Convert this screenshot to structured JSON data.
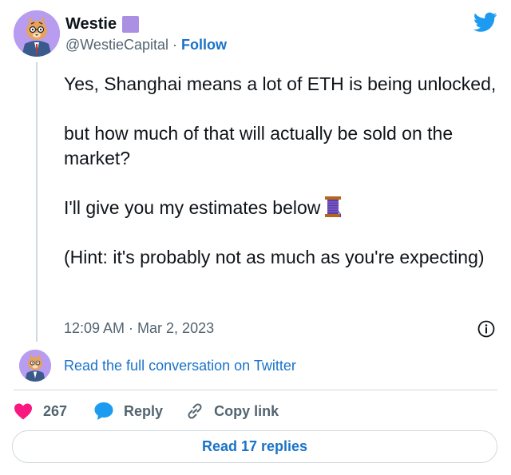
{
  "author": {
    "name": "Westie",
    "handle": "@WestieCapital",
    "separator": " · ",
    "follow_label": "Follow"
  },
  "tweet": {
    "paragraphs": [
      "Yes, Shanghai means a lot of ETH is being unlocked,",
      "but how much of that will actually be sold on the market?",
      "I'll give you my estimates below",
      "(Hint: it's probably not as much as you're expecting)"
    ],
    "timestamp": "12:09 AM · Mar 2, 2023"
  },
  "conversation_link": "Read the full conversation on Twitter",
  "actions": {
    "like_count": "267",
    "reply_label": "Reply",
    "copy_label": "Copy link"
  },
  "read_replies_label": "Read 17 replies",
  "colors": {
    "link_blue": "#1a73c8",
    "like_red": "#f91880",
    "reply_blue": "#1d9bf0",
    "badge_purple": "#ab8fe3",
    "twitter_blue": "#1d9bf0"
  },
  "icons": {
    "brand": "twitter-bird-icon",
    "badge": "purple-square-emoji",
    "spool": "thread-spool-emoji",
    "info": "info-icon",
    "like": "heart-icon",
    "reply": "speech-bubble-icon",
    "copy": "link-icon"
  }
}
